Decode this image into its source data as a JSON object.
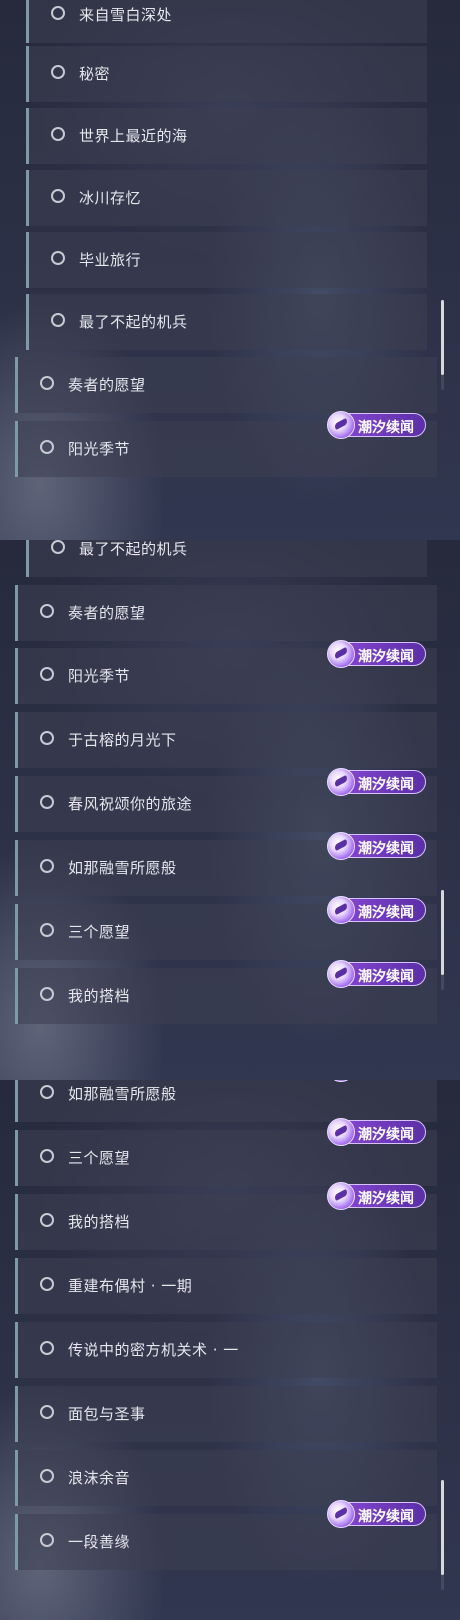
{
  "badge_label": "潮汐续闻",
  "panel1": [
    {
      "label": "来自雪白深处",
      "kind": "child"
    },
    {
      "label": "秘密",
      "kind": "child"
    },
    {
      "label": "世界上最近的海",
      "kind": "child"
    },
    {
      "label": "冰川存忆",
      "kind": "child"
    },
    {
      "label": "毕业旅行",
      "kind": "child"
    },
    {
      "label": "最了不起的机兵",
      "kind": "child"
    },
    {
      "label": "奏者的愿望",
      "kind": "top"
    },
    {
      "label": "阳光季节",
      "kind": "top"
    }
  ],
  "panel2": [
    {
      "label": "最了不起的机兵",
      "kind": "child"
    },
    {
      "label": "奏者的愿望",
      "kind": "top"
    },
    {
      "label": "阳光季节",
      "kind": "top"
    },
    {
      "label": "于古榕的月光下",
      "kind": "top"
    },
    {
      "label": "春风祝颂你的旅途",
      "kind": "top"
    },
    {
      "label": "如那融雪所愿般",
      "kind": "top"
    },
    {
      "label": "三个愿望",
      "kind": "top"
    },
    {
      "label": "我的搭档",
      "kind": "top"
    }
  ],
  "panel3": [
    {
      "label": "如那融雪所愿般",
      "kind": "top"
    },
    {
      "label": "三个愿望",
      "kind": "top"
    },
    {
      "label": "我的搭档",
      "kind": "top"
    },
    {
      "label": "重建布偶村 · 一期",
      "kind": "top"
    },
    {
      "label": "传说中的密方机关术 · 一",
      "kind": "top"
    },
    {
      "label": "面包与圣事",
      "kind": "top"
    },
    {
      "label": "浪沫余音",
      "kind": "top"
    },
    {
      "label": "一段善缘",
      "kind": "top"
    }
  ],
  "colors": {
    "accent_bar": "#7d9aa8",
    "badge_purple": "#8a49d6"
  },
  "icons": {
    "radio": "radio-circle-icon",
    "badge": "star-bird-icon"
  }
}
